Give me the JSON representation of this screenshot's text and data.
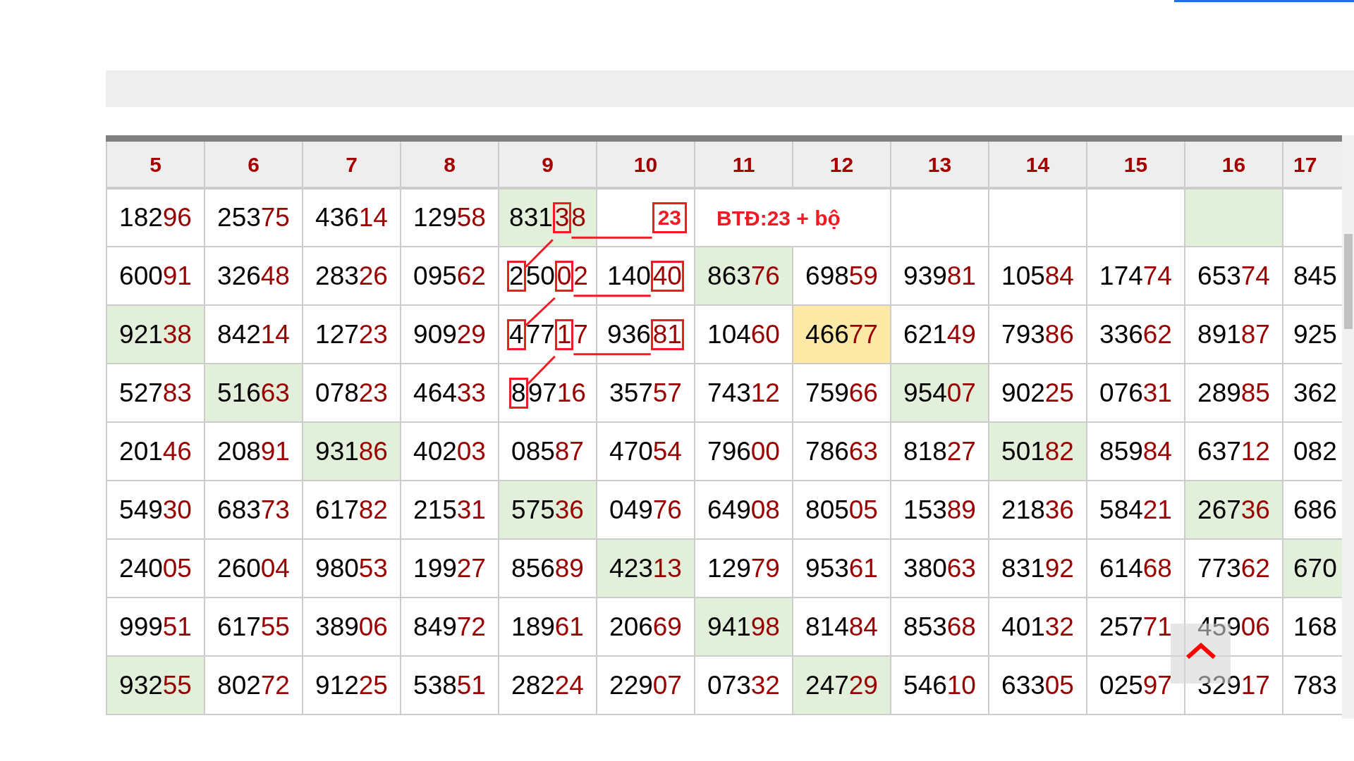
{
  "columns": [
    "5",
    "6",
    "7",
    "8",
    "9",
    "10",
    "11",
    "12",
    "13",
    "14",
    "15",
    "16",
    "17"
  ],
  "rows": [
    {
      "cells": [
        {
          "text": "18296"
        },
        {
          "text": "25375"
        },
        {
          "text": "43614"
        },
        {
          "text": "12958"
        },
        {
          "color": "#e2efda",
          "segments": [
            {
              "text": "831"
            },
            {
              "text": "3",
              "boxed": true,
              "link_right": true,
              "link_down": true
            },
            {
              "text": "8"
            }
          ]
        },
        {
          "kind": "tag",
          "text": "23"
        },
        {
          "kind": "note",
          "text": "BTĐ:23 + bộ"
        },
        {
          "kind": "empty"
        },
        {
          "kind": "empty"
        },
        {
          "kind": "empty"
        },
        {
          "kind": "empty",
          "color": "#e2efda"
        },
        {
          "kind": "empty"
        }
      ]
    },
    {
      "cells": [
        {
          "text": "60091"
        },
        {
          "text": "32648"
        },
        {
          "text": "28326"
        },
        {
          "text": "09562"
        },
        {
          "segments": [
            {
              "text": "2",
              "boxed": true
            },
            {
              "text": "50"
            },
            {
              "text": "0",
              "boxed": true,
              "link_right": true,
              "link_down": true
            },
            {
              "text": "2"
            }
          ]
        },
        {
          "segments": [
            {
              "text": "140"
            },
            {
              "text": "40",
              "boxed": true
            }
          ]
        },
        {
          "text": "86376",
          "color": "#e2efda"
        },
        {
          "text": "69859"
        },
        {
          "text": "93981"
        },
        {
          "text": "10584"
        },
        {
          "text": "17474"
        },
        {
          "text": "65374"
        },
        {
          "text": "845"
        }
      ]
    },
    {
      "cells": [
        {
          "text": "92138",
          "color": "#e2efda"
        },
        {
          "text": "84214"
        },
        {
          "text": "12723"
        },
        {
          "text": "90929"
        },
        {
          "segments": [
            {
              "text": "4",
              "boxed": true
            },
            {
              "text": "77"
            },
            {
              "text": "1",
              "boxed": true,
              "link_right": true,
              "link_down": true
            },
            {
              "text": "7"
            }
          ]
        },
        {
          "segments": [
            {
              "text": "936"
            },
            {
              "text": "81",
              "boxed": true
            }
          ]
        },
        {
          "text": "10460"
        },
        {
          "text": "46677",
          "color": "#ffe9a6"
        },
        {
          "text": "62149"
        },
        {
          "text": "79386"
        },
        {
          "text": "33662"
        },
        {
          "text": "89187"
        },
        {
          "text": "925"
        }
      ]
    },
    {
      "cells": [
        {
          "text": "52783"
        },
        {
          "text": "51663",
          "color": "#e2efda"
        },
        {
          "text": "07823"
        },
        {
          "text": "46433"
        },
        {
          "segments": [
            {
              "text": "8",
              "boxed": true
            },
            {
              "text": "9716"
            }
          ]
        },
        {
          "text": "35757"
        },
        {
          "text": "74312"
        },
        {
          "text": "75966"
        },
        {
          "text": "95407",
          "color": "#e2efda"
        },
        {
          "text": "90225"
        },
        {
          "text": "07631"
        },
        {
          "text": "28985"
        },
        {
          "text": "362"
        }
      ]
    },
    {
      "cells": [
        {
          "text": "20146"
        },
        {
          "text": "20891"
        },
        {
          "text": "93186",
          "color": "#e2efda"
        },
        {
          "text": "40203"
        },
        {
          "text": "08587"
        },
        {
          "text": "47054"
        },
        {
          "text": "79600"
        },
        {
          "text": "78663"
        },
        {
          "text": "81827"
        },
        {
          "text": "50182",
          "color": "#e2efda"
        },
        {
          "text": "85984"
        },
        {
          "text": "63712"
        },
        {
          "text": "082"
        }
      ]
    },
    {
      "cells": [
        {
          "text": "54930"
        },
        {
          "text": "68373"
        },
        {
          "text": "61782"
        },
        {
          "text": "21531"
        },
        {
          "text": "57536",
          "color": "#e2efda"
        },
        {
          "text": "04976"
        },
        {
          "text": "64908"
        },
        {
          "text": "80505"
        },
        {
          "text": "15389"
        },
        {
          "text": "21836"
        },
        {
          "text": "58421"
        },
        {
          "text": "26736",
          "color": "#e2efda"
        },
        {
          "text": "686"
        }
      ]
    },
    {
      "cells": [
        {
          "text": "24005"
        },
        {
          "text": "26004"
        },
        {
          "text": "98053"
        },
        {
          "text": "19927"
        },
        {
          "text": "85689"
        },
        {
          "text": "42313",
          "color": "#e2efda"
        },
        {
          "text": "12979"
        },
        {
          "text": "95361"
        },
        {
          "text": "38063"
        },
        {
          "text": "83192"
        },
        {
          "text": "61468"
        },
        {
          "text": "77362"
        },
        {
          "text": "670",
          "color": "#e2efda"
        }
      ]
    },
    {
      "cells": [
        {
          "text": "99951"
        },
        {
          "text": "61755"
        },
        {
          "text": "38906"
        },
        {
          "text": "84972"
        },
        {
          "text": "18961"
        },
        {
          "text": "20669"
        },
        {
          "text": "94198",
          "color": "#e2efda"
        },
        {
          "text": "81484"
        },
        {
          "text": "85368"
        },
        {
          "text": "40132"
        },
        {
          "text": "25771"
        },
        {
          "text": "45906"
        },
        {
          "text": "168"
        }
      ]
    },
    {
      "cells": [
        {
          "text": "93255",
          "color": "#e2efda"
        },
        {
          "text": "80272"
        },
        {
          "text": "91225"
        },
        {
          "text": "53851"
        },
        {
          "text": "28224"
        },
        {
          "text": "22907"
        },
        {
          "text": "07332"
        },
        {
          "text": "24729",
          "color": "#e2efda"
        },
        {
          "text": "54610"
        },
        {
          "text": "63305"
        },
        {
          "text": "02597"
        },
        {
          "text": "32917"
        },
        {
          "text": "783"
        }
      ]
    }
  ]
}
